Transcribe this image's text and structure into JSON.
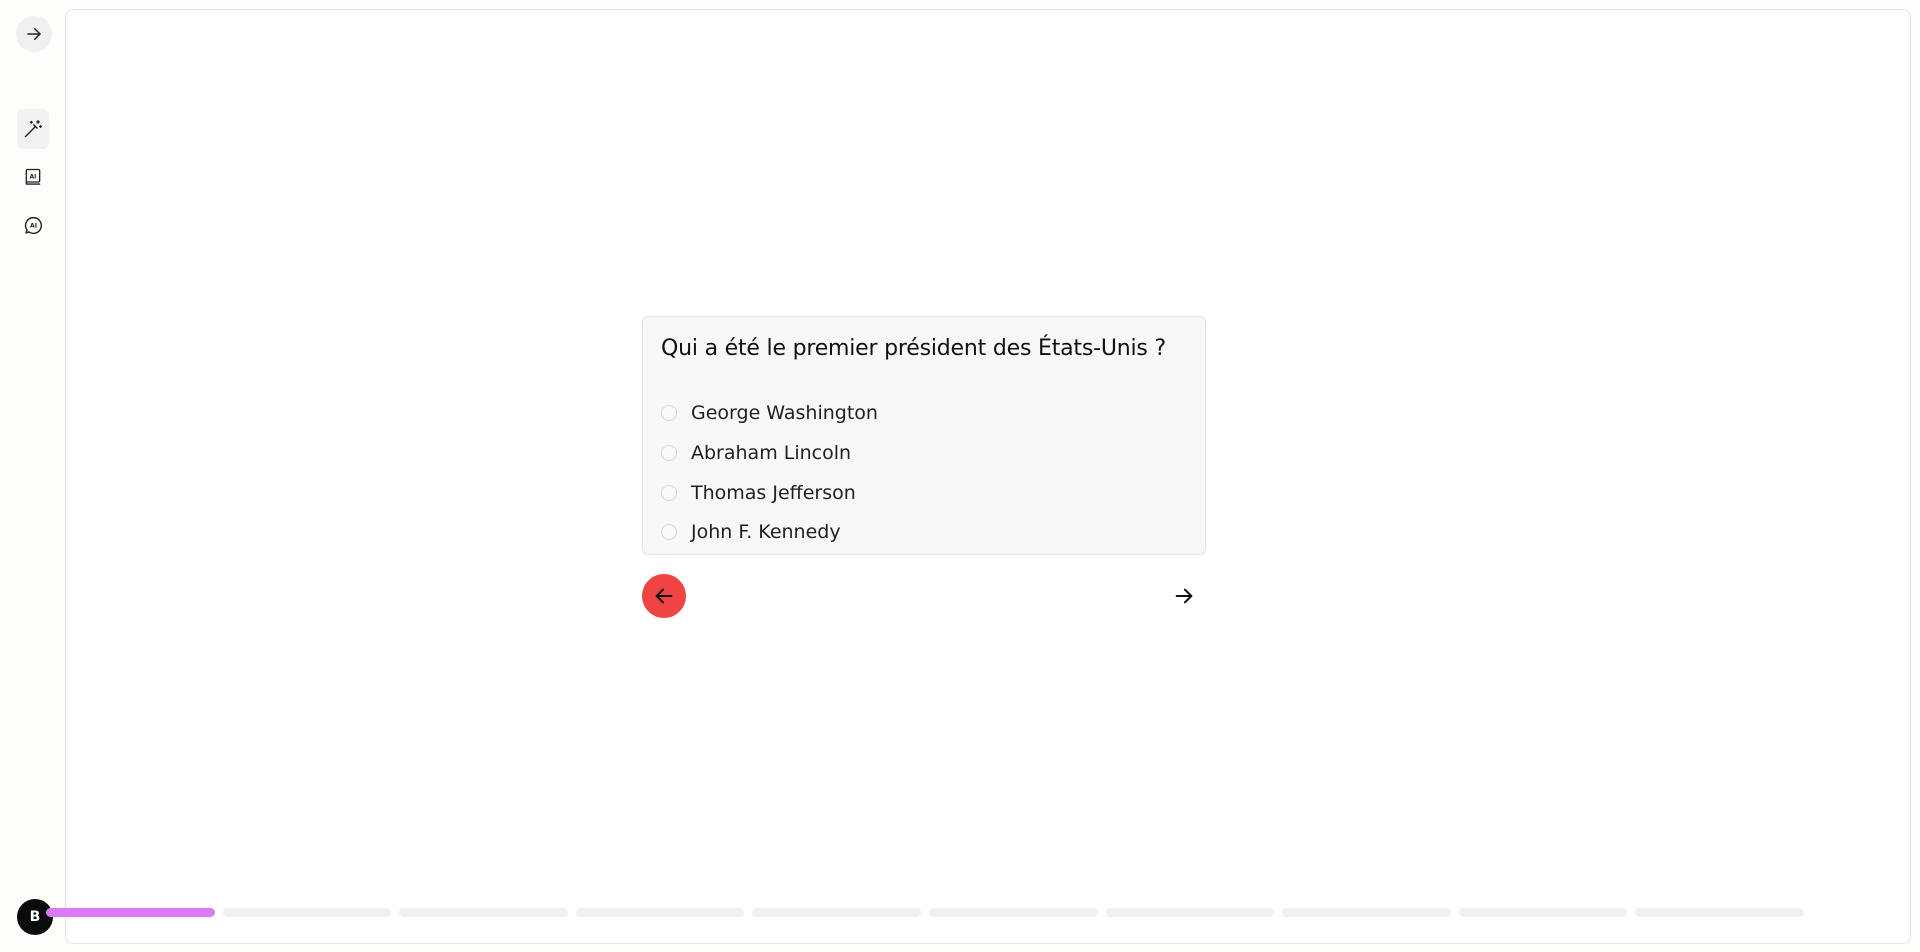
{
  "sidebar": {
    "expand_icon": "arrow-right-icon",
    "tools": [
      {
        "name": "magic-wand-icon",
        "active": true
      },
      {
        "name": "ai-book-icon",
        "active": false
      },
      {
        "name": "ai-chat-icon",
        "active": false
      }
    ],
    "avatar_initial": "B"
  },
  "quiz": {
    "question": "Qui a été le premier président des États-Unis ?",
    "options": [
      {
        "label": "George Washington",
        "selected": false
      },
      {
        "label": "Abraham Lincoln",
        "selected": false
      },
      {
        "label": "Thomas Jefferson",
        "selected": false
      },
      {
        "label": "John F. Kennedy",
        "selected": false
      }
    ]
  },
  "navigation": {
    "back_icon": "arrow-left-icon",
    "next_icon": "arrow-right-icon",
    "back_color": "#ef4444"
  },
  "progress": {
    "current": 1,
    "total": 10,
    "active_color": "#d97cf4"
  }
}
